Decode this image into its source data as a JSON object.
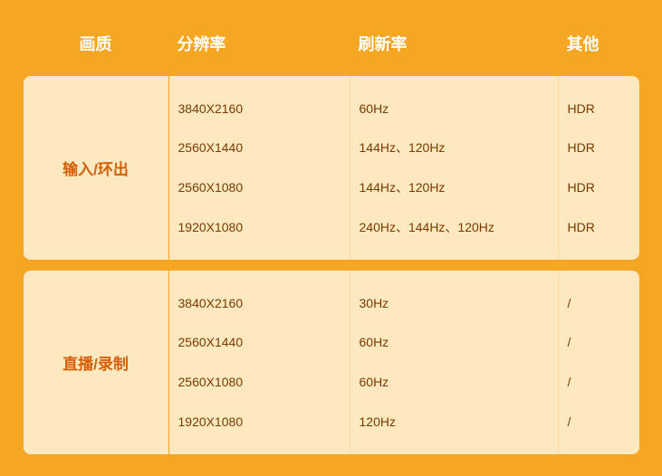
{
  "header": {
    "col1": "画质",
    "col2": "分辨率",
    "col3": "刷新率",
    "col4": "其他"
  },
  "rows": [
    {
      "label": "输入/环出",
      "resolutions": [
        "3840X2160",
        "2560X1440",
        "2560X1080",
        "1920X1080"
      ],
      "refresh_rates": [
        "60Hz",
        "144Hz、120Hz",
        "144Hz、120Hz",
        "240Hz、144Hz、120Hz"
      ],
      "other": [
        "HDR",
        "HDR",
        "HDR",
        "HDR"
      ]
    },
    {
      "label": "直播/录制",
      "resolutions": [
        "3840X2160",
        "2560X1440",
        "2560X1080",
        "1920X1080"
      ],
      "refresh_rates": [
        "30Hz",
        "60Hz",
        "60Hz",
        "120Hz"
      ],
      "other": [
        "/",
        "/",
        "/",
        "/"
      ]
    }
  ]
}
